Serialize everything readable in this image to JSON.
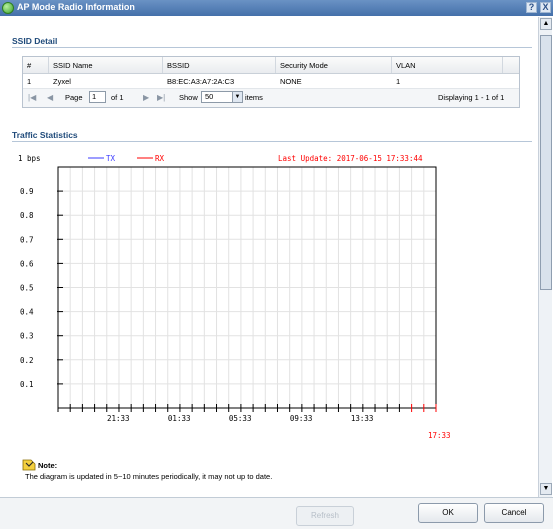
{
  "window": {
    "title": "AP Mode Radio Information",
    "help_label": "?",
    "close_label": "X"
  },
  "ssid_detail": {
    "title": "SSID Detail",
    "columns": [
      "#",
      "SSID Name",
      "BSSID",
      "Security Mode",
      "VLAN"
    ],
    "rows": [
      {
        "num": "1",
        "ssid": "Zyxel",
        "bssid": "B8:EC:A3:A7:2A:C3",
        "security": "NONE",
        "vlan": "1"
      }
    ],
    "pager": {
      "page_label": "Page",
      "page_value": "1",
      "of_label": "of 1",
      "show_label": "Show",
      "show_value": "50",
      "items_label": "items",
      "displaying": "Displaying 1 - 1 of 1"
    }
  },
  "traffic": {
    "title": "Traffic Statistics"
  },
  "chart_data": {
    "type": "line",
    "y_unit_label": "1 bps",
    "y_ticks": [
      "0.9",
      "0.8",
      "0.7",
      "0.6",
      "0.5",
      "0.4",
      "0.3",
      "0.2",
      "0.1"
    ],
    "x_ticks": [
      "21:33",
      "01:33",
      "05:33",
      "09:33",
      "13:33"
    ],
    "x_last_label": "17:33",
    "ylim": [
      0,
      1
    ],
    "legend": [
      "TX",
      "RX"
    ],
    "legend_placement": "top",
    "series": [
      {
        "name": "TX",
        "color": "#3b3bff",
        "values": []
      },
      {
        "name": "RX",
        "color": "#ff0000",
        "values": []
      }
    ],
    "last_update": "Last Update: 2017-06-15 17:33:44",
    "grid": true
  },
  "note": {
    "title": "Note:",
    "text": "The diagram is updated in 5~10 minutes periodically, it may not up to date."
  },
  "footer": {
    "refresh_label": "Refresh",
    "ok_label": "OK",
    "cancel_label": "Cancel"
  },
  "colors": {
    "titlebar": "#4f7ab3",
    "section_title": "#1f4a7a",
    "tx": "#3b3bff",
    "rx": "#ff0000"
  }
}
